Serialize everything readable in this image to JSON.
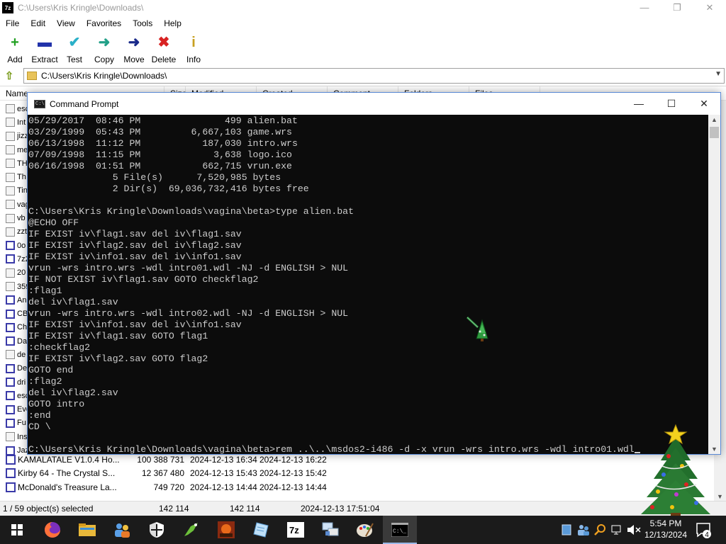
{
  "sevenzip": {
    "app_icon": "7z",
    "title": "C:\\Users\\Kris Kringle\\Downloads\\",
    "window_controls": {
      "minimize": "—",
      "restore": "❐",
      "close": "✕"
    },
    "menu": [
      "File",
      "Edit",
      "View",
      "Favorites",
      "Tools",
      "Help"
    ],
    "toolbar": [
      {
        "label": "Add",
        "icon": "add-icon",
        "glyph": "+",
        "color": "#22a022"
      },
      {
        "label": "Extract",
        "icon": "extract-icon",
        "glyph": "▬",
        "color": "#2233aa"
      },
      {
        "label": "Test",
        "icon": "test-icon",
        "glyph": "✔",
        "color": "#2ab0c8"
      },
      {
        "label": "Copy",
        "icon": "copy-icon",
        "glyph": "➜",
        "color": "#22a088"
      },
      {
        "label": "Move",
        "icon": "move-icon",
        "glyph": "➜",
        "color": "#1a2a8a"
      },
      {
        "label": "Delete",
        "icon": "delete-icon",
        "glyph": "✖",
        "color": "#d82222"
      },
      {
        "label": "Info",
        "icon": "info-icon",
        "glyph": "i",
        "color": "#c8a020"
      }
    ],
    "address": "C:\\Users\\Kris Kringle\\Downloads\\",
    "columns": [
      "Name",
      "Size",
      "Modified",
      "Created",
      "Comment",
      "Folders",
      "Files"
    ],
    "left_rows": [
      {
        "text": "esc",
        "type": "folder"
      },
      {
        "text": "Int",
        "type": "folder"
      },
      {
        "text": "jizz",
        "type": "folder"
      },
      {
        "text": "me",
        "type": "folder"
      },
      {
        "text": "TH",
        "type": "folder"
      },
      {
        "text": "Th",
        "type": "folder"
      },
      {
        "text": "Tin",
        "type": "folder"
      },
      {
        "text": "vag",
        "type": "folder"
      },
      {
        "text": "vb",
        "type": "folder"
      },
      {
        "text": "zzt",
        "type": "folder"
      },
      {
        "text": "0o",
        "type": "archive"
      },
      {
        "text": "7z2",
        "type": "archive"
      },
      {
        "text": "20",
        "type": "file"
      },
      {
        "text": "359",
        "type": "file"
      },
      {
        "text": "An",
        "type": "archive"
      },
      {
        "text": "CB",
        "type": "archive"
      },
      {
        "text": "Ch",
        "type": "archive"
      },
      {
        "text": "Da",
        "type": "archive"
      },
      {
        "text": "de",
        "type": "file"
      },
      {
        "text": "De",
        "type": "archive"
      },
      {
        "text": "dri",
        "type": "archive"
      },
      {
        "text": "esc",
        "type": "archive"
      },
      {
        "text": "Eve",
        "type": "archive"
      },
      {
        "text": "Fu",
        "type": "archive"
      },
      {
        "text": "Ins",
        "type": "file"
      },
      {
        "text": "Jaz",
        "type": "archive"
      }
    ],
    "bottom_rows": [
      {
        "name": "KAMALATALE V1.0.4 Ho...",
        "size": "100 388 731",
        "modified": "2024-12-13 16:34",
        "created": "2024-12-13 16:22"
      },
      {
        "name": "Kirby 64 - The Crystal S...",
        "size": "12 367 480",
        "modified": "2024-12-13 15:43",
        "created": "2024-12-13 15:42"
      },
      {
        "name": "McDonald's Treasure La...",
        "size": "749 720",
        "modified": "2024-12-13 14:44",
        "created": "2024-12-13 14:44"
      }
    ],
    "status": {
      "selected": "1 / 59 object(s) selected",
      "size1": "142 114",
      "size2": "142 114",
      "datetime": "2024-12-13 17:51:04"
    }
  },
  "cmd": {
    "title": "Command Prompt",
    "window_controls": {
      "minimize": "—",
      "maximize": "☐",
      "close": "✕"
    },
    "lines": [
      "05/29/2017  08:46 PM               499 alien.bat",
      "03/29/1999  05:43 PM         6,667,103 game.wrs",
      "06/13/1998  11:12 PM           187,030 intro.wrs",
      "07/09/1998  11:15 PM             3,638 logo.ico",
      "06/16/1998  01:51 PM           662,715 vrun.exe",
      "               5 File(s)      7,520,985 bytes",
      "               2 Dir(s)  69,036,732,416 bytes free",
      "",
      "C:\\Users\\Kris Kringle\\Downloads\\vagina\\beta>type alien.bat",
      "@ECHO OFF",
      "IF EXIST iv\\flag1.sav del iv\\flag1.sav",
      "IF EXIST iv\\flag2.sav del iv\\flag2.sav",
      "IF EXIST iv\\info1.sav del iv\\info1.sav",
      "vrun -wrs intro.wrs -wdl intro01.wdl -NJ -d ENGLISH > NUL",
      "IF NOT EXIST iv\\flag1.sav GOTO checkflag2",
      ":flag1",
      "del iv\\flag1.sav",
      "vrun -wrs intro.wrs -wdl intro02.wdl -NJ -d ENGLISH > NUL",
      "IF EXIST iv\\info1.sav del iv\\info1.sav",
      "IF EXIST iv\\flag1.sav GOTO flag1",
      ":checkflag2",
      "IF EXIST iv\\flag2.sav GOTO flag2",
      "GOTO end",
      ":flag2",
      "del iv\\flag2.sav",
      "GOTO intro",
      ":end",
      "CD \\",
      ""
    ],
    "prompt_line": "C:\\Users\\Kris Kringle\\Downloads\\vagina\\beta>rem ..\\..\\msdos2-i486 -d -x vrun -wrs intro.wrs -wdl intro01.wdl"
  },
  "taskbar": {
    "items": [
      {
        "name": "start-button",
        "icon": "windows-icon"
      },
      {
        "name": "firefox",
        "icon": "firefox-icon"
      },
      {
        "name": "file-explorer",
        "icon": "folder-icon"
      },
      {
        "name": "people-app",
        "icon": "people-icon"
      },
      {
        "name": "security",
        "icon": "shield-icon"
      },
      {
        "name": "green-app",
        "icon": "bird-icon"
      },
      {
        "name": "game-app",
        "icon": "game-icon"
      },
      {
        "name": "notes-app",
        "icon": "notepad-icon"
      },
      {
        "name": "7zip",
        "icon": "7zip-icon"
      },
      {
        "name": "network-app",
        "icon": "network-icon"
      },
      {
        "name": "paint",
        "icon": "paint-icon"
      },
      {
        "name": "command-prompt",
        "icon": "cmd-icon"
      }
    ],
    "clock_time": "5:54 PM",
    "clock_date": "12/13/2024",
    "notification_count": "4"
  }
}
